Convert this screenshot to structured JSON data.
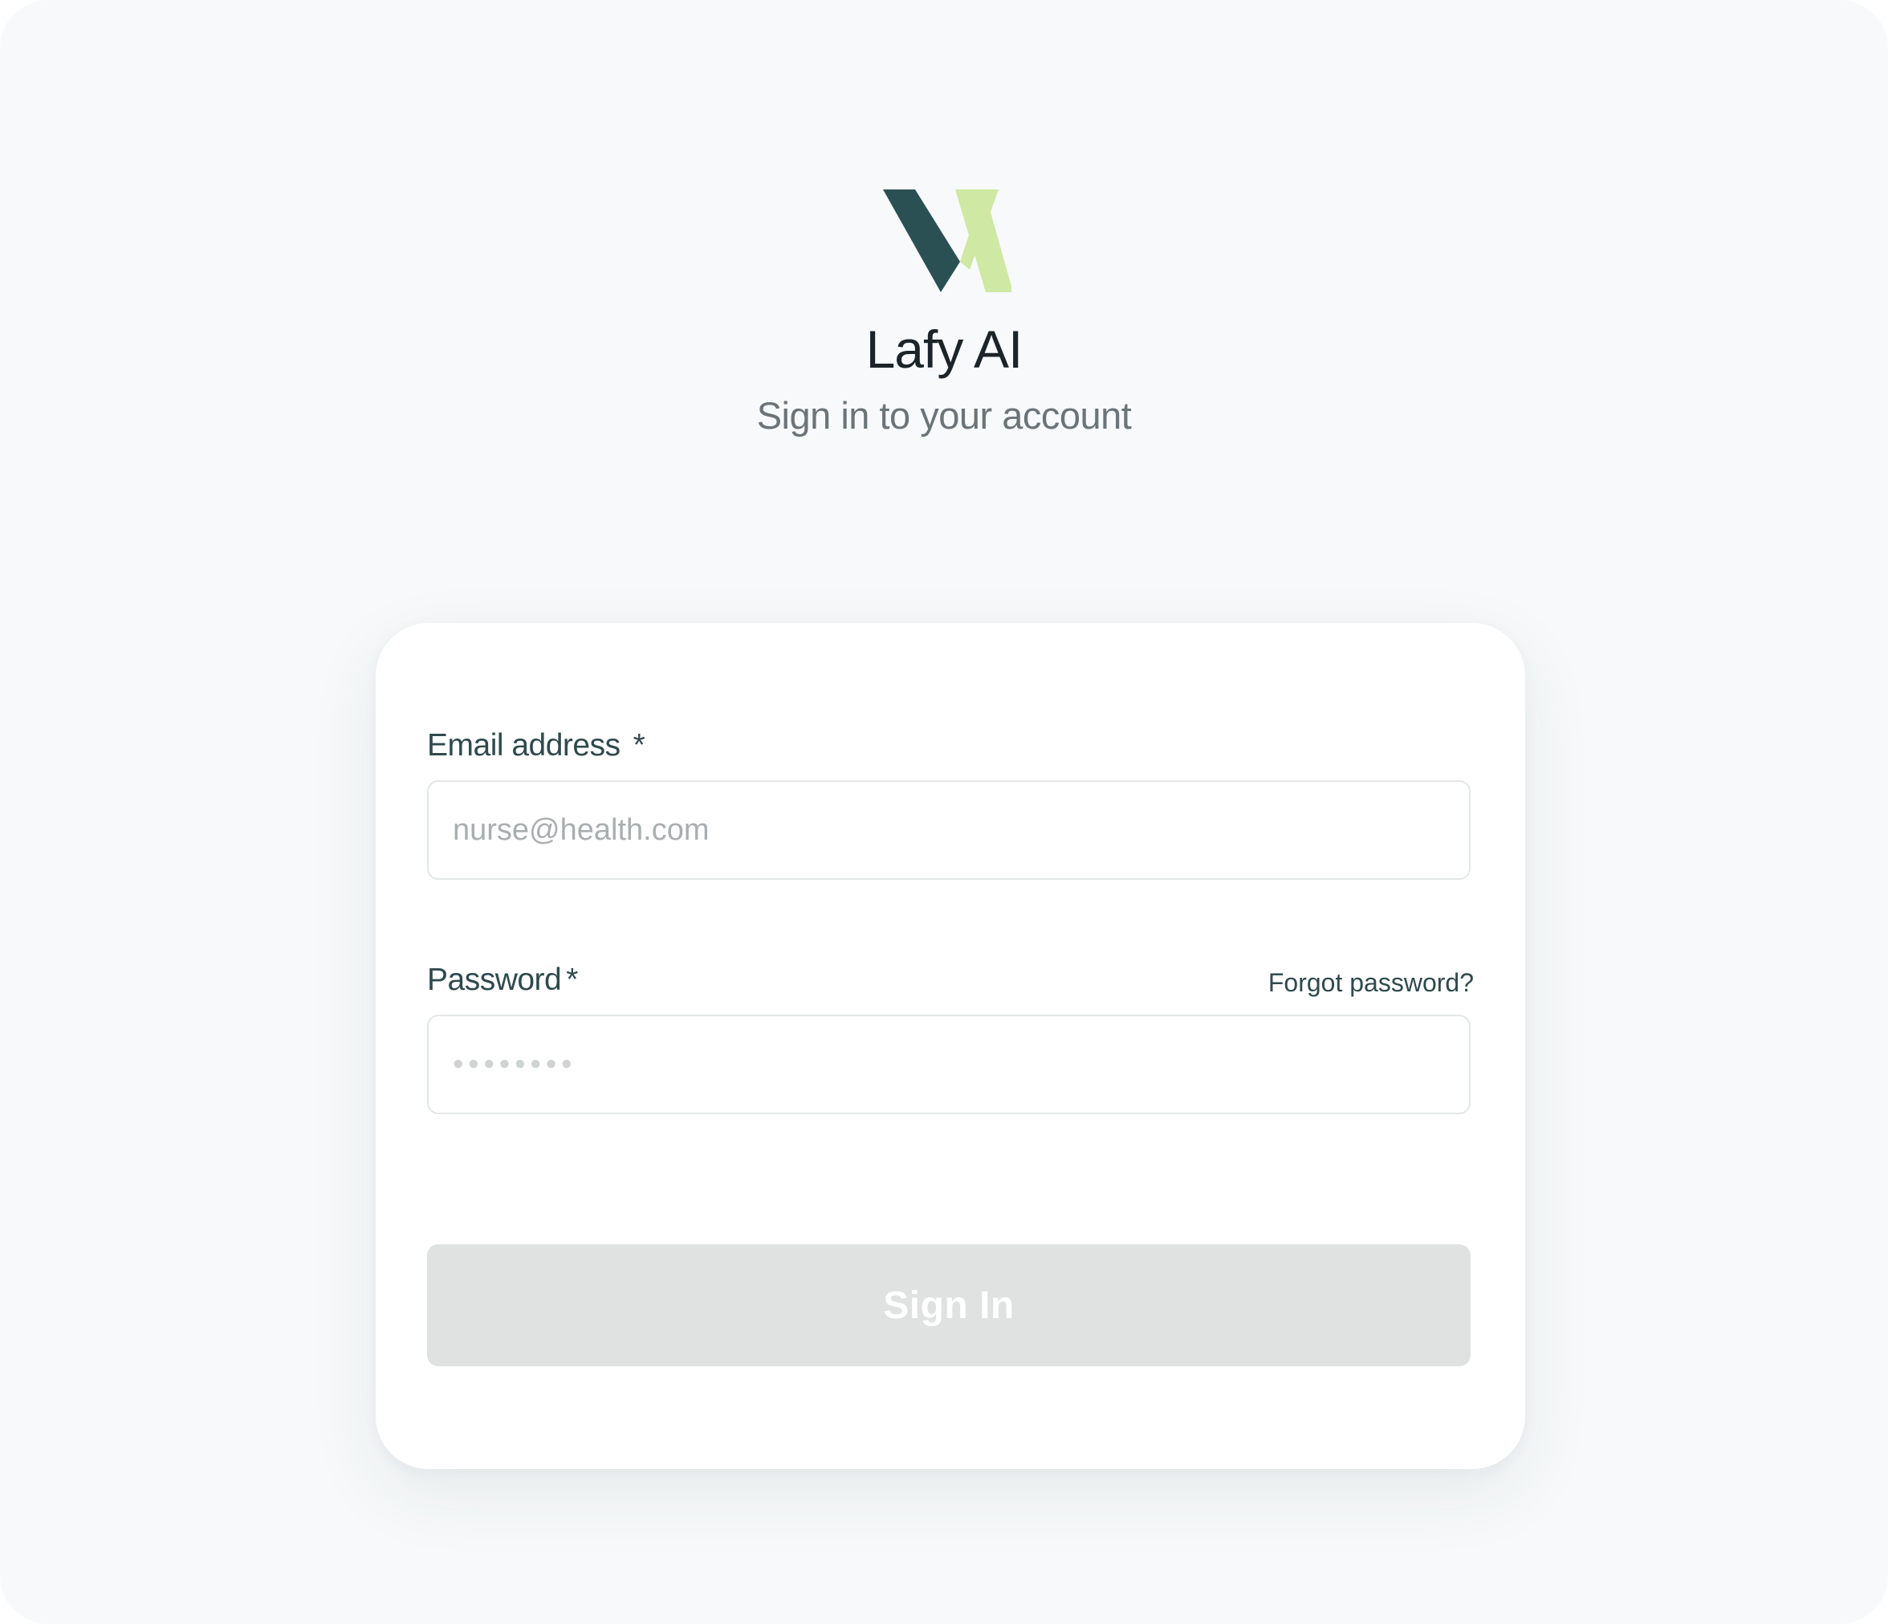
{
  "brand": {
    "name": "Lafy AI",
    "logo_icon": "lafy-logo-icon",
    "logo_colors": {
      "dark": "#2b5053",
      "light": "#cfe8a3"
    }
  },
  "header": {
    "subtitle": "Sign in to your account"
  },
  "form": {
    "email": {
      "label": "Email address",
      "required_marker": "*",
      "placeholder": "nurse@health.com",
      "value": ""
    },
    "password": {
      "label": "Password",
      "required_marker": "*",
      "placeholder": "••••••••",
      "value": "",
      "forgot_link": "Forgot password?"
    },
    "submit": {
      "label": "Sign In",
      "state": "disabled"
    }
  },
  "colors": {
    "background": "#f7f9fa",
    "card": "#ffffff",
    "label": "#2f4a4d",
    "button_disabled": "#e0e1e1"
  }
}
